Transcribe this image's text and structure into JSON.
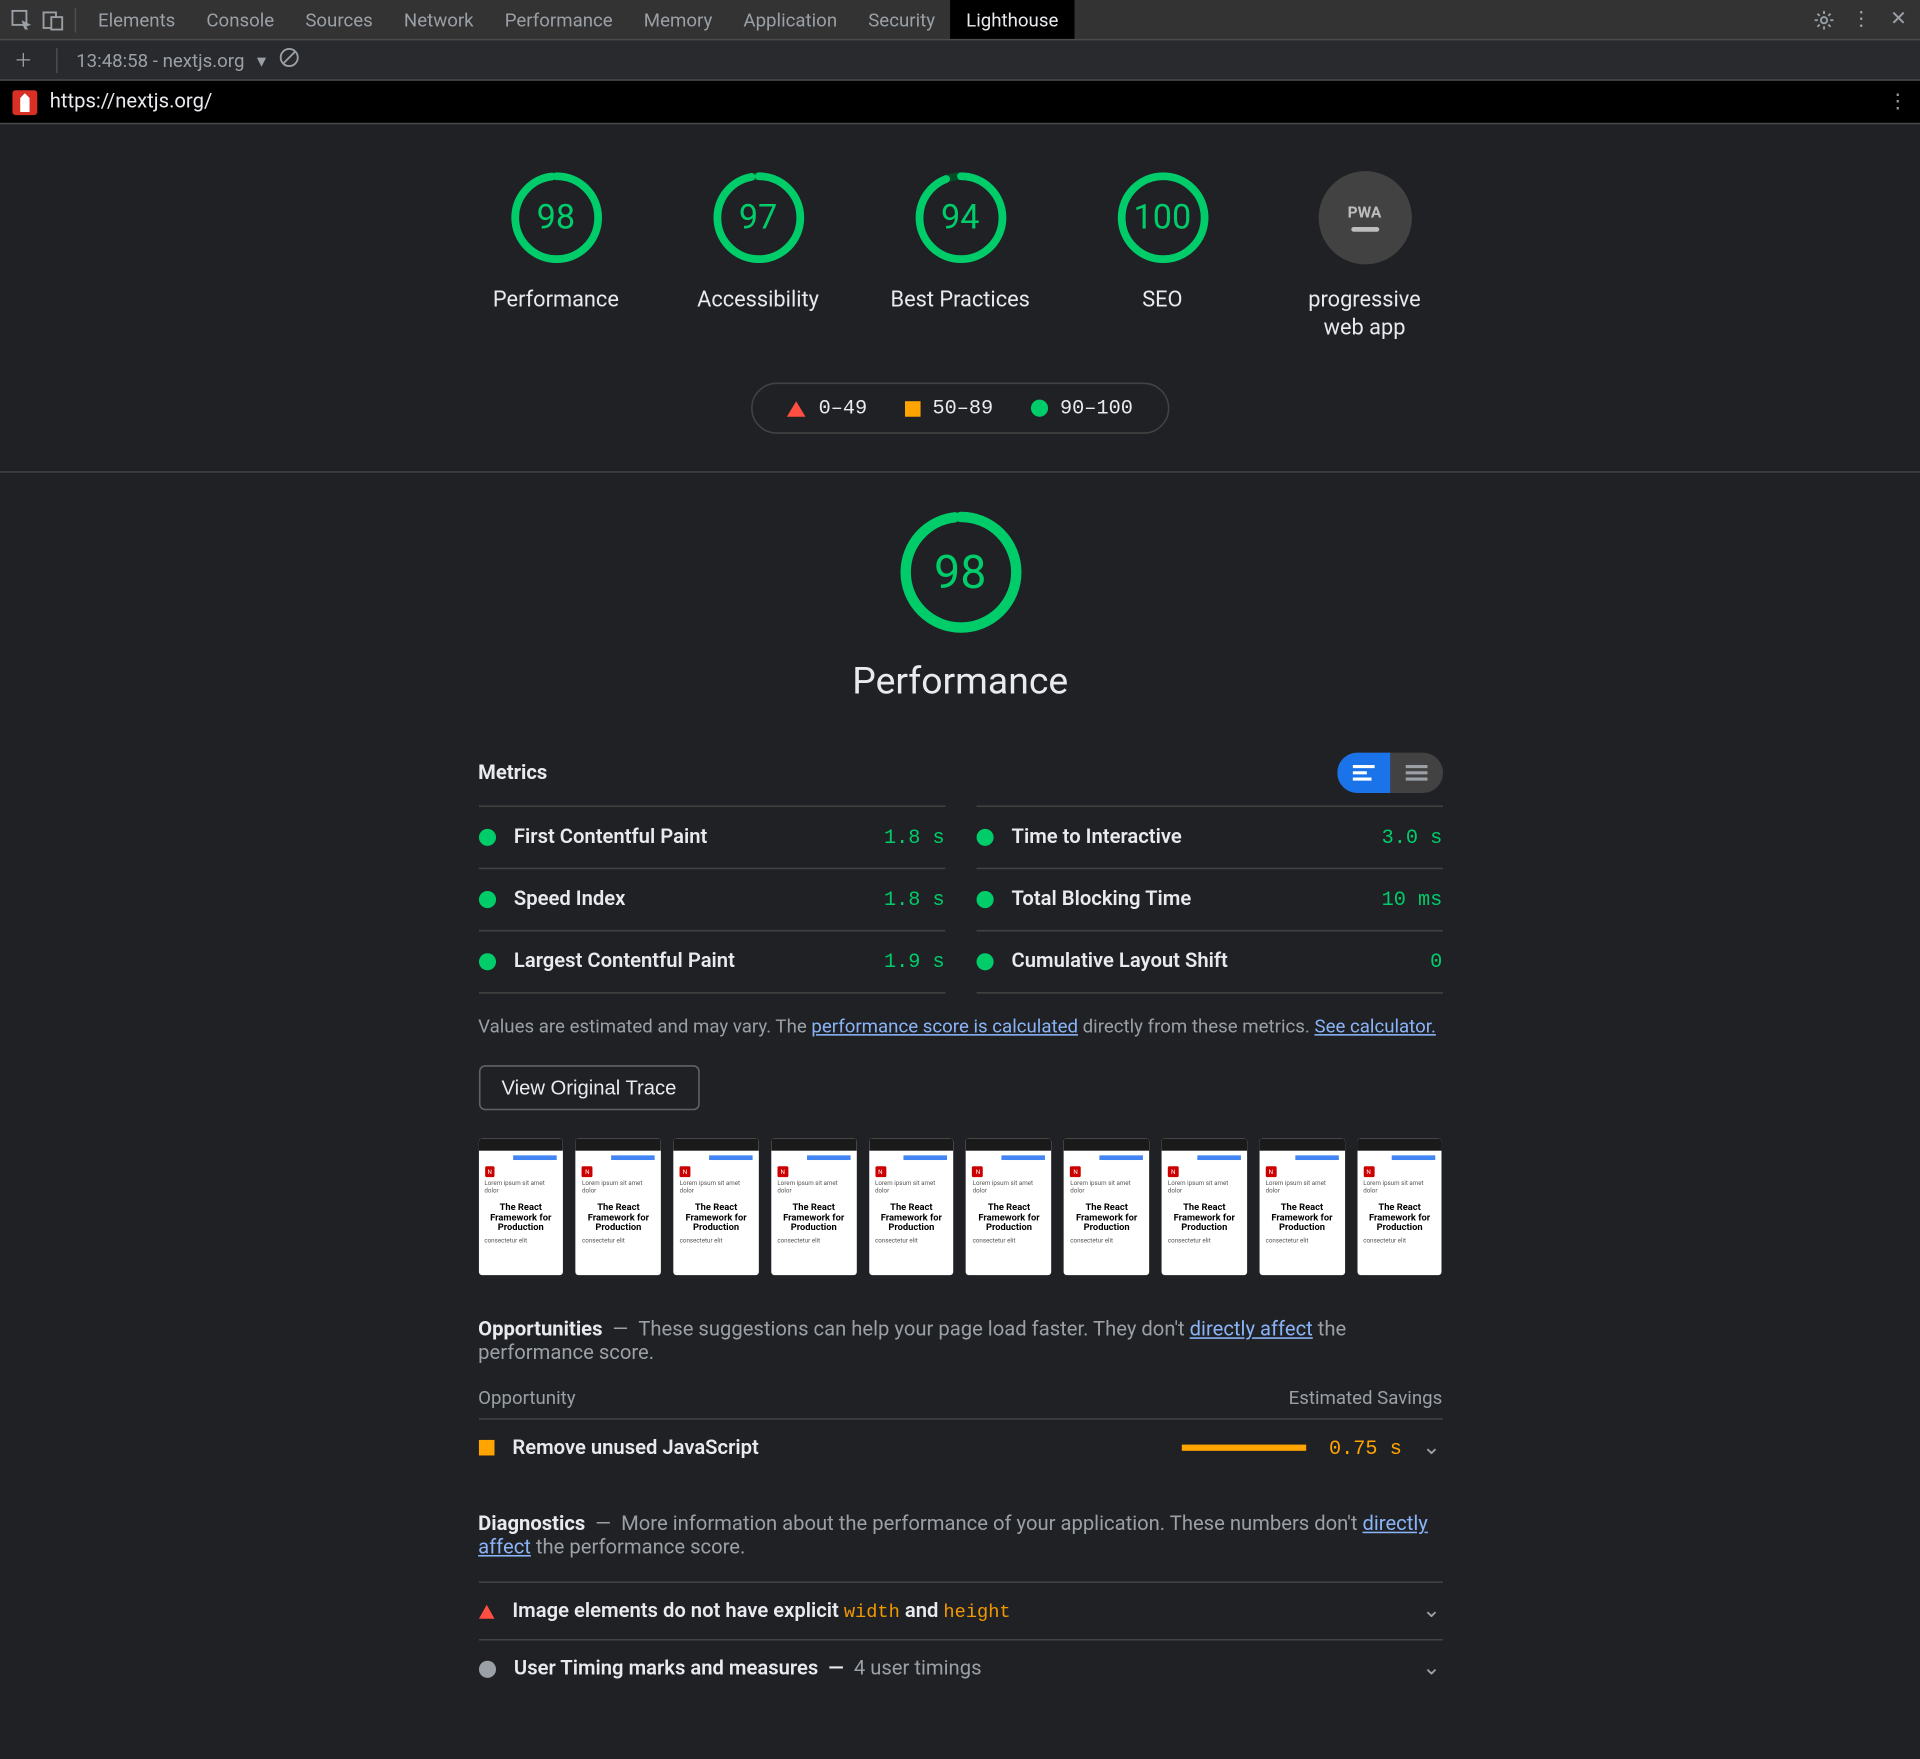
{
  "toolbar": {
    "tabs": [
      "Elements",
      "Console",
      "Sources",
      "Network",
      "Performance",
      "Memory",
      "Application",
      "Security",
      "Lighthouse"
    ],
    "active_tab": "Lighthouse"
  },
  "subtoolbar": {
    "timestamp": "13:48:58 - nextjs.org"
  },
  "urlbar": {
    "url": "https://nextjs.org/"
  },
  "gauges": [
    {
      "score": 98,
      "label": "Performance"
    },
    {
      "score": 97,
      "label": "Accessibility"
    },
    {
      "score": 94,
      "label": "Best Practices"
    },
    {
      "score": 100,
      "label": "SEO"
    }
  ],
  "pwa": {
    "badge": "PWA",
    "label": "progressive web app"
  },
  "legend": {
    "red": "0–49",
    "orange": "50–89",
    "green": "90–100"
  },
  "big": {
    "score": 98,
    "title": "Performance"
  },
  "metrics_title": "Metrics",
  "metrics_left": [
    {
      "name": "First Contentful Paint",
      "value": "1.8 s"
    },
    {
      "name": "Speed Index",
      "value": "1.8 s"
    },
    {
      "name": "Largest Contentful Paint",
      "value": "1.9 s"
    }
  ],
  "metrics_right": [
    {
      "name": "Time to Interactive",
      "value": "3.0 s"
    },
    {
      "name": "Total Blocking Time",
      "value": "10 ms"
    },
    {
      "name": "Cumulative Layout Shift",
      "value": "0"
    }
  ],
  "metrics_note": {
    "pre": "Values are estimated and may vary. The ",
    "link1": "performance score is calculated",
    "mid": " directly from these metrics. ",
    "link2": "See calculator."
  },
  "trace_btn": "View Original Trace",
  "filmstrip_headline": "The React Framework for Production",
  "opportunities": {
    "title": "Opportunities",
    "desc_pre": "These suggestions can help your page load faster. They don't ",
    "desc_link": "directly affect",
    "desc_post": " the performance score.",
    "col_left": "Opportunity",
    "col_right": "Estimated Savings",
    "rows": [
      {
        "name": "Remove unused JavaScript",
        "value": "0.75 s",
        "bar_pct": 100
      }
    ]
  },
  "diagnostics": {
    "title": "Diagnostics",
    "desc_pre": "More information about the performance of your application. These numbers don't ",
    "desc_link": "directly affect",
    "desc_post": " the performance score.",
    "rows": [
      {
        "icon": "triangle",
        "html_pre": "Image elements do not have explicit ",
        "code1": "width",
        "mid": " and ",
        "code2": "height"
      },
      {
        "icon": "gray-dot",
        "html_pre": "User Timing marks and measures",
        "sub": "4 user timings"
      }
    ]
  }
}
